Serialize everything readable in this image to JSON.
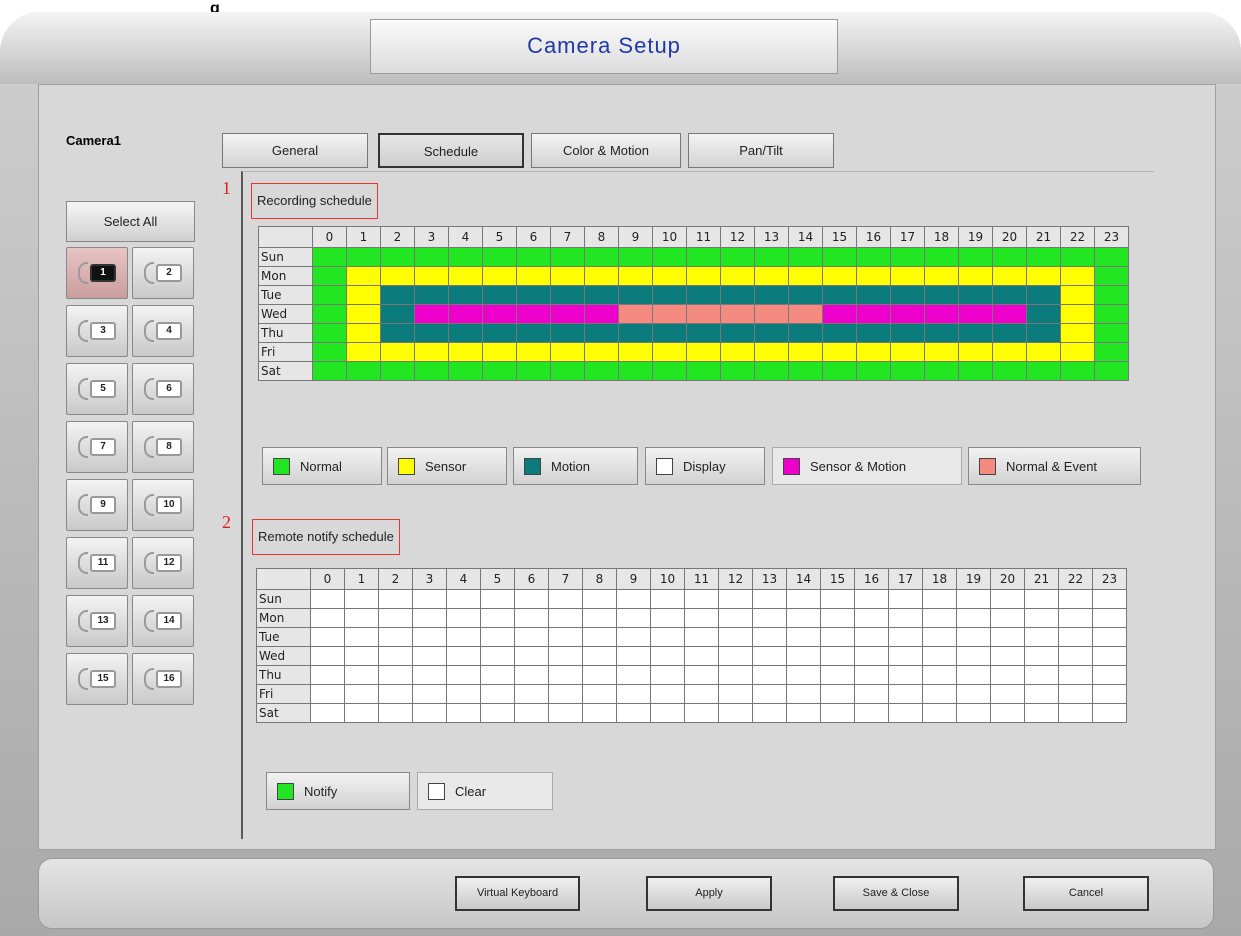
{
  "header": {
    "fragment": "g",
    "title": "Camera Setup"
  },
  "sidebar": {
    "camera_label": "Camera1",
    "select_all": "Select All",
    "cameras": [
      "1",
      "2",
      "3",
      "4",
      "5",
      "6",
      "7",
      "8",
      "9",
      "10",
      "11",
      "12",
      "13",
      "14",
      "15",
      "16"
    ],
    "active_camera": "1"
  },
  "tabs": [
    {
      "label": "General",
      "active": false
    },
    {
      "label": "Schedule",
      "active": true
    },
    {
      "label": "Color & Motion",
      "active": false
    },
    {
      "label": "Pan/Tilt",
      "active": false
    }
  ],
  "recording": {
    "annotation": "1",
    "title": "Recording schedule",
    "hours": [
      "0",
      "1",
      "2",
      "3",
      "4",
      "5",
      "6",
      "7",
      "8",
      "9",
      "10",
      "11",
      "12",
      "13",
      "14",
      "15",
      "16",
      "17",
      "18",
      "19",
      "20",
      "21",
      "22",
      "23"
    ],
    "days": [
      "Sun",
      "Mon",
      "Tue",
      "Wed",
      "Thu",
      "Fri",
      "Sat"
    ],
    "rows": [
      "NNNNNNNNNNNNNNNNNNNNNNNN",
      "NSSSSSSSSSSSSSSSSSSSSSSN",
      "NSMMMMMMMMMMMMMMMMMMMMSN",
      "NSMXXXXXXEEEEEEXXXXXXMSN",
      "NSMMMMMMMMMMMMMMMMMMMMSN",
      "NSSSSSSSSSSSSSSSSSSSSSSN",
      "NNNNNNNNNNNNNNNNNNNNNNNN"
    ],
    "legend": [
      {
        "code": "N",
        "label": "Normal",
        "color": "#22e622"
      },
      {
        "code": "S",
        "label": "Sensor",
        "color": "#ffff00"
      },
      {
        "code": "M",
        "label": "Motion",
        "color": "#0b7b7b"
      },
      {
        "code": "D",
        "label": "Display",
        "color": "#ffffff"
      },
      {
        "code": "X",
        "label": "Sensor & Motion",
        "color": "#ee00cc"
      },
      {
        "code": "E",
        "label": "Normal & Event",
        "color": "#f58a80"
      }
    ],
    "active_legend": "X"
  },
  "notify": {
    "annotation": "2",
    "title": "Remote notify schedule",
    "rows": [
      "DDDDDDDDDDDDDDDDDDDDDDDD",
      "DDDDDDDDDDDDDDDDDDDDDDDD",
      "DDDDDDDDDDDDDDDDDDDDDDDD",
      "DDDDDDDDDDDDDDDDDDDDDDDD",
      "DDDDDDDDDDDDDDDDDDDDDDDD",
      "DDDDDDDDDDDDDDDDDDDDDDDD",
      "DDDDDDDDDDDDDDDDDDDDDDDD"
    ],
    "legend": [
      {
        "code": "N",
        "label": "Notify",
        "color": "#22e622"
      },
      {
        "code": "D",
        "label": "Clear",
        "color": "#ffffff"
      }
    ],
    "active_legend": "D"
  },
  "footer": {
    "virtual_keyboard": "Virtual Keyboard",
    "apply": "Apply",
    "save_close": "Save & Close",
    "cancel": "Cancel"
  }
}
